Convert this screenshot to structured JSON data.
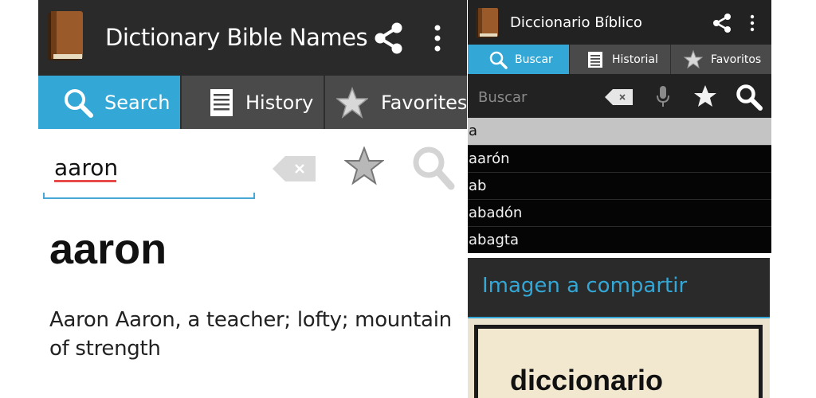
{
  "left_screen": {
    "app_title": "Dictionary Bible Names",
    "tabs": [
      {
        "label": "Search",
        "icon": "search-icon",
        "active": true
      },
      {
        "label": "History",
        "icon": "list-icon",
        "active": false
      },
      {
        "label": "Favorites",
        "icon": "star-icon",
        "active": false
      }
    ],
    "search_input_value": "aaron",
    "result_word": "aaron",
    "result_definition": "Aaron Aaron, a teacher; lofty; mountain of strength"
  },
  "right_screen": {
    "app_title": "Diccionario Bíblico",
    "tabs": [
      {
        "label": "Buscar",
        "icon": "search-icon",
        "active": true
      },
      {
        "label": "Historial",
        "icon": "list-icon",
        "active": false
      },
      {
        "label": "Favoritos",
        "icon": "star-icon",
        "active": false
      }
    ],
    "search_placeholder": "Buscar",
    "suggestions": [
      {
        "text": "a",
        "selected": true
      },
      {
        "text": "aarón",
        "selected": false
      },
      {
        "text": "ab",
        "selected": false
      },
      {
        "text": "abadón",
        "selected": false
      },
      {
        "text": "abagta",
        "selected": false
      }
    ],
    "dialog_title": "Imagen a compartir",
    "dialog_preview_word": "diccionario"
  },
  "colors": {
    "accent": "#33a7d6",
    "actionbar": "#2a2a2a",
    "tabbar": "#4a4a4a",
    "misspell_underline": "#e84a4a"
  }
}
